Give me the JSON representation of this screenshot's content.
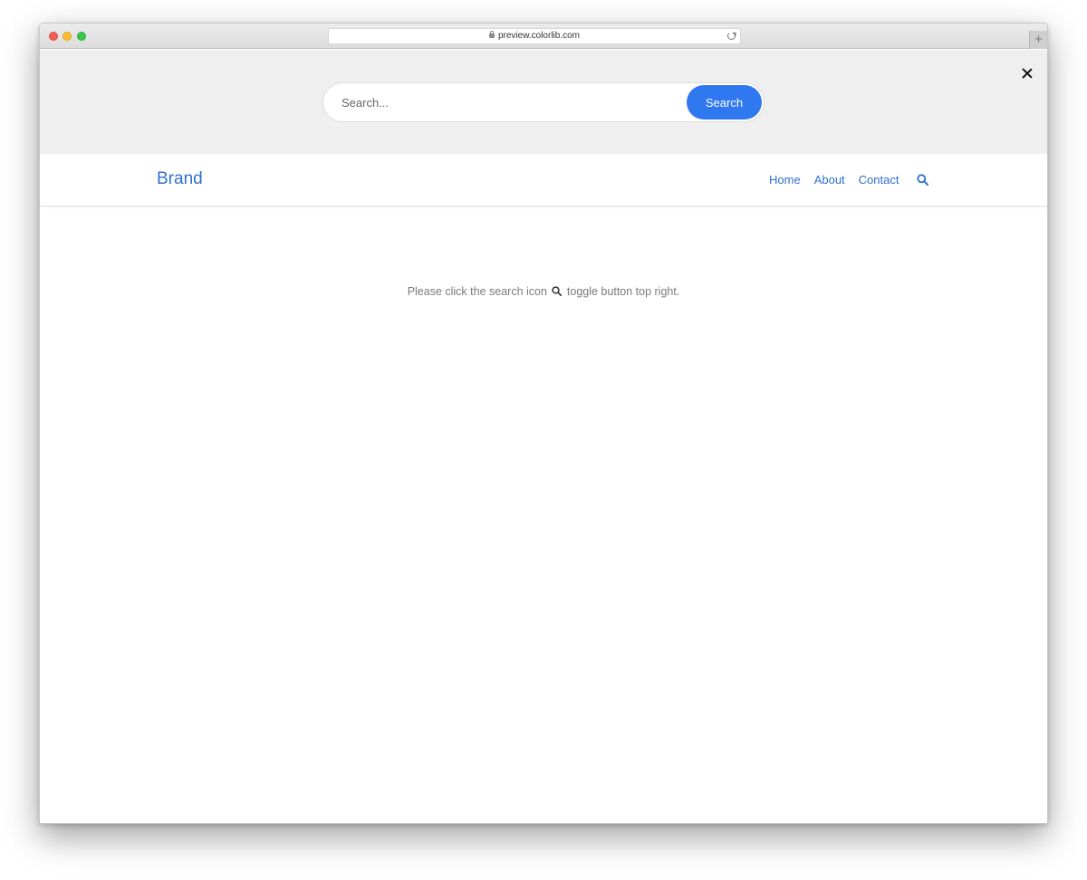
{
  "browser": {
    "url": "preview.colorlib.com",
    "newtab_label": "+"
  },
  "search": {
    "placeholder": "Search...",
    "button_label": "Search",
    "close_icon": "close-icon"
  },
  "navbar": {
    "brand": "Brand",
    "links": [
      {
        "label": "Home"
      },
      {
        "label": "About"
      },
      {
        "label": "Contact"
      }
    ],
    "toggle_icon": "search-icon"
  },
  "main": {
    "message_before": "Please click the search icon",
    "message_after": "toggle button top right."
  },
  "colors": {
    "accent": "#3078f0",
    "link": "#2f6fd0",
    "panel_bg": "#efefef",
    "muted_text": "#7a7a7a"
  }
}
